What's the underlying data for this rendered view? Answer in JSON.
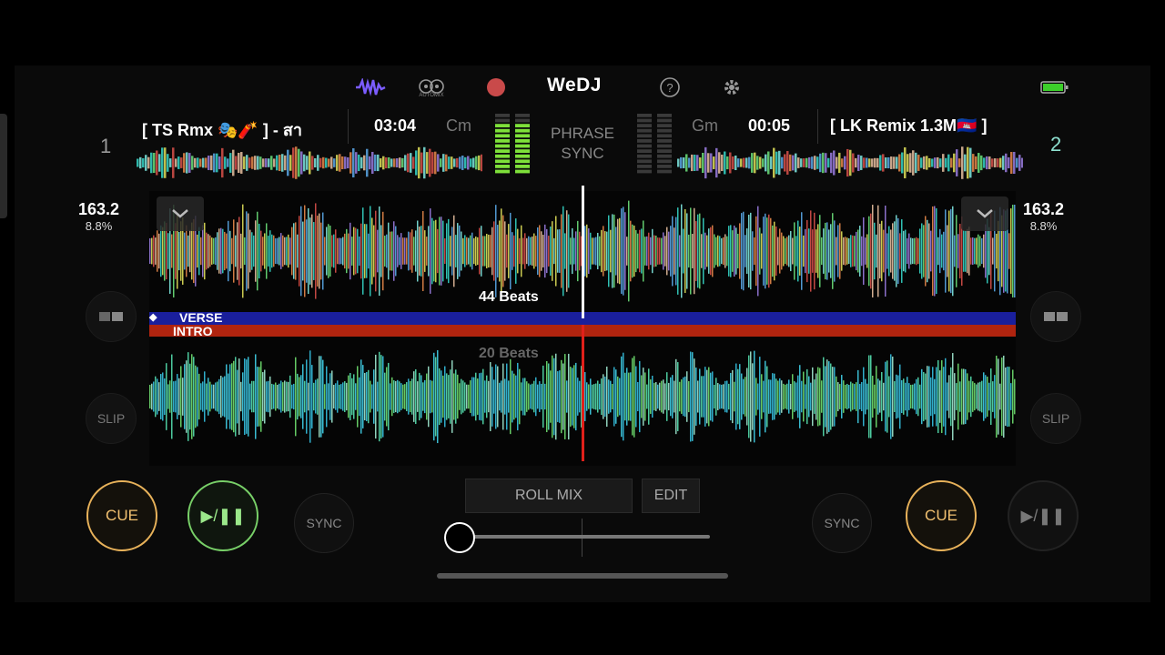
{
  "app": {
    "brand": "WeDJ",
    "automix_label": "AUTOMIX"
  },
  "icons": [
    "waveform-icon",
    "automix-icon",
    "record-icon",
    "help-icon",
    "settings-icon",
    "battery-icon"
  ],
  "deck1": {
    "number": "1",
    "title": "[ TS Rmx 🎭🧨 ] - สา",
    "time": "03:04",
    "key": "Cm",
    "bpm": "163.2",
    "pitch": "8.8%",
    "cue_label": "CUE",
    "play_label": "▶/❚❚",
    "sync_label": "SYNC",
    "slip_label": "SLIP"
  },
  "deck2": {
    "number": "2",
    "title": "[ LK Remix 1.3M🇰🇭 ]",
    "time": "00:05",
    "key": "Gm",
    "bpm": "163.2",
    "pitch": "8.8%",
    "cue_label": "CUE",
    "play_label": "▶/❚❚",
    "sync_label": "SYNC",
    "slip_label": "SLIP"
  },
  "center": {
    "phrase_sync_line1": "PHRASE",
    "phrase_sync_line2": "SYNC",
    "beats_top": "44 Beats",
    "beats_bottom": "20 Beats",
    "section_top": "VERSE",
    "section_bottom": "INTRO",
    "roll_mix": "ROLL MIX",
    "edit": "EDIT"
  },
  "colors": {
    "accent_cue": "#e8b25a",
    "accent_play": "#78d068",
    "record": "#c94a4a",
    "battery": "#3ccf2a"
  }
}
